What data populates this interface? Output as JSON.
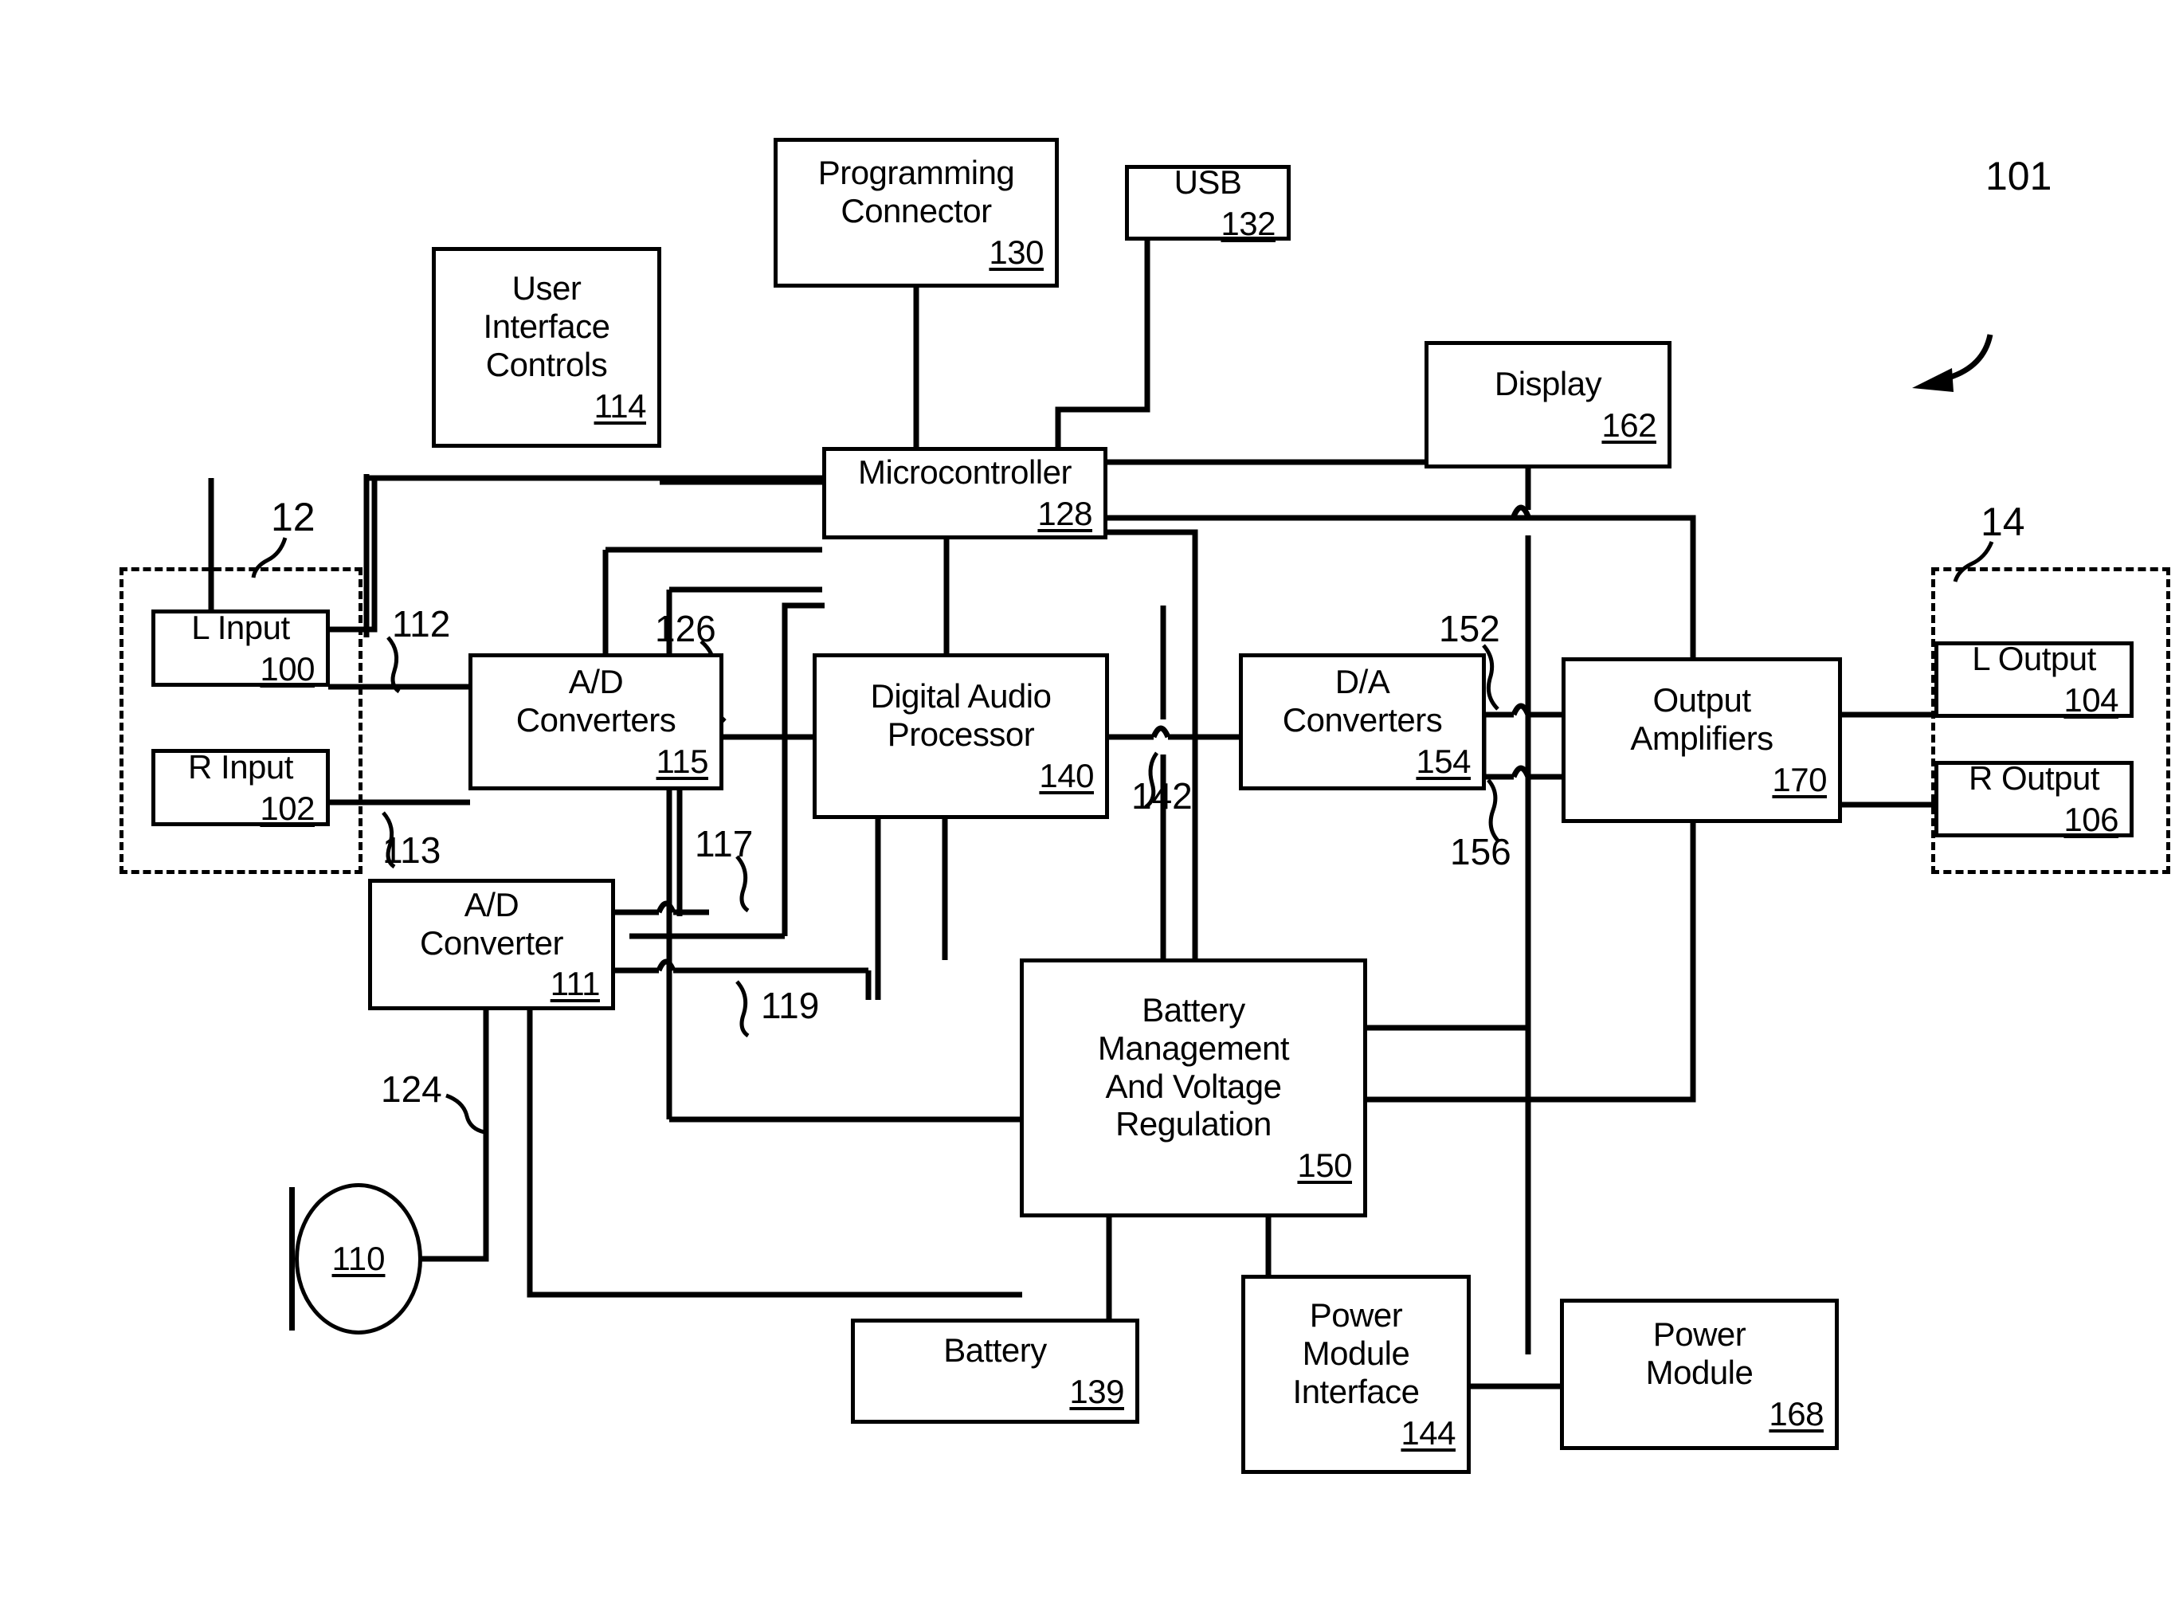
{
  "figure": {
    "ref": "101",
    "dashed_groups": [
      {
        "id": "input-group",
        "ref": "12"
      },
      {
        "id": "output-group",
        "ref": "14"
      }
    ]
  },
  "blocks": [
    {
      "id": "l-input",
      "label": "L Input",
      "ref": "100"
    },
    {
      "id": "r-input",
      "label": "R Input",
      "ref": "102"
    },
    {
      "id": "l-output",
      "label": "L Output",
      "ref": "104"
    },
    {
      "id": "r-output",
      "label": "R Output",
      "ref": "106"
    },
    {
      "id": "microphone",
      "label": "",
      "ref": "110"
    },
    {
      "id": "ad-converter-single",
      "label": "A/D\nConverter",
      "ref": "111"
    },
    {
      "id": "ad-converters",
      "label": "A/D\nConverters",
      "ref": "115"
    },
    {
      "id": "user-interface",
      "label": "User\nInterface\nControls",
      "ref": "114"
    },
    {
      "id": "microcontroller",
      "label": "Microcontroller",
      "ref": "128"
    },
    {
      "id": "programming-connector",
      "label": "Programming\nConnector",
      "ref": "130"
    },
    {
      "id": "usb",
      "label": "USB",
      "ref": "132"
    },
    {
      "id": "battery",
      "label": "Battery",
      "ref": "139"
    },
    {
      "id": "digital-audio-processor",
      "label": "Digital Audio\nProcessor",
      "ref": "140"
    },
    {
      "id": "power-module-interface",
      "label": "Power\nModule\nInterface",
      "ref": "144"
    },
    {
      "id": "battery-management",
      "label": "Battery\nManagement\nAnd Voltage\nRegulation",
      "ref": "150"
    },
    {
      "id": "da-converters",
      "label": "D/A\nConverters",
      "ref": "154"
    },
    {
      "id": "display",
      "label": "Display",
      "ref": "162"
    },
    {
      "id": "power-module",
      "label": "Power\nModule",
      "ref": "168"
    },
    {
      "id": "output-amplifiers",
      "label": "Output\nAmplifiers",
      "ref": "170"
    }
  ],
  "signal_labels": [
    {
      "id": "sig-112",
      "ref": "112"
    },
    {
      "id": "sig-113",
      "ref": "113"
    },
    {
      "id": "sig-117",
      "ref": "117"
    },
    {
      "id": "sig-119",
      "ref": "119"
    },
    {
      "id": "sig-124",
      "ref": "124"
    },
    {
      "id": "sig-126",
      "ref": "126"
    },
    {
      "id": "sig-142",
      "ref": "142"
    },
    {
      "id": "sig-152",
      "ref": "152"
    },
    {
      "id": "sig-156",
      "ref": "156"
    }
  ]
}
